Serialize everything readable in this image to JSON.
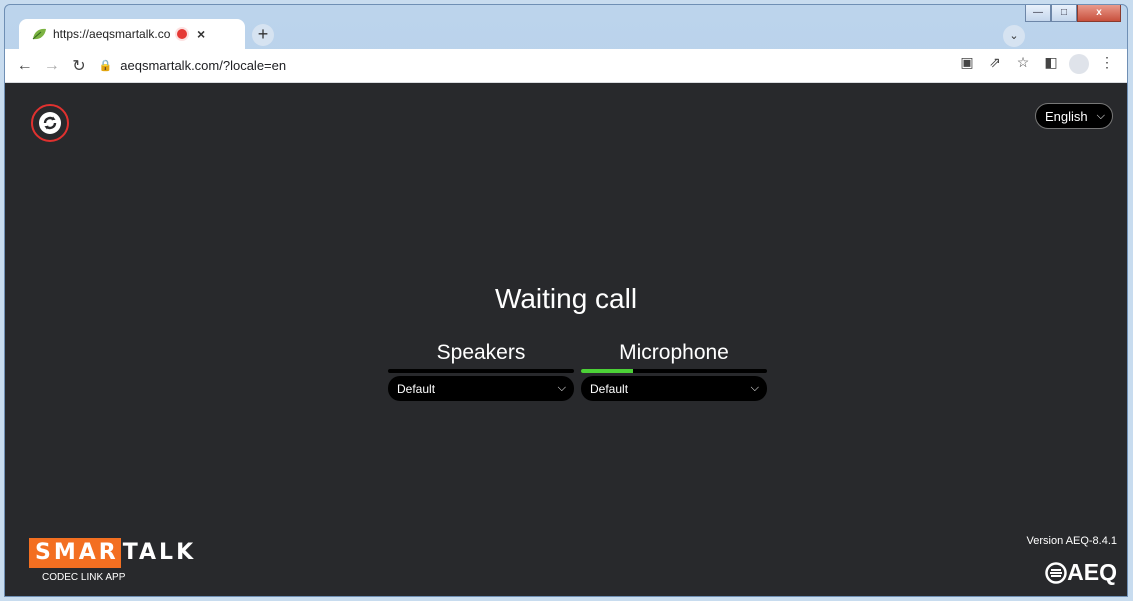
{
  "browser": {
    "tab_title": "https://aeqsmartalk.com/?lo",
    "tab_close": "×",
    "new_tab": "+",
    "url": "aeqsmartalk.com/?locale=en"
  },
  "app": {
    "language": "English",
    "status": "Waiting call",
    "speakers": {
      "label": "Speakers",
      "selected": "Default",
      "level": 0
    },
    "microphone": {
      "label": "Microphone",
      "selected": "Default",
      "level": 0.28
    },
    "version": "Version AEQ-8.4.1",
    "brand": {
      "logo_part1": "SMAR",
      "logo_part2": "TALK",
      "tagline": "CODEC LINK APP",
      "aeq": "AEQ"
    },
    "colors": {
      "background": "#28292c",
      "accent": "#f36f21",
      "meter": "#4cd137",
      "refresh_ring": "#e0312f"
    }
  }
}
